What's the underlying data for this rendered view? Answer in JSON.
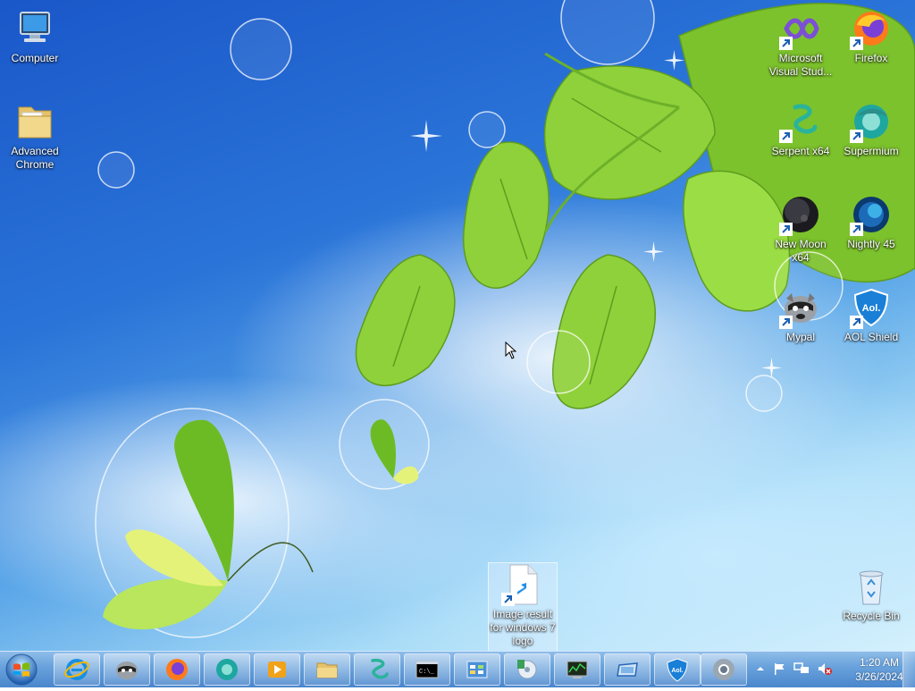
{
  "desktop": {
    "left_icons": [
      {
        "label": "Computer",
        "icon": "computer-icon"
      },
      {
        "label": "Advanced Chrome",
        "icon": "folder-icon"
      }
    ],
    "right_icons": [
      {
        "label": "Microsoft Visual Stud...",
        "icon": "visual-studio-icon"
      },
      {
        "label": "Firefox",
        "icon": "firefox-icon"
      },
      {
        "label": "Serpent x64",
        "icon": "serpent-icon"
      },
      {
        "label": "Supermium",
        "icon": "supermium-icon"
      },
      {
        "label": "New Moon x64",
        "icon": "new-moon-icon"
      },
      {
        "label": "Nightly 45",
        "icon": "nightly-icon"
      },
      {
        "label": "Mypal",
        "icon": "mypal-icon"
      },
      {
        "label": "AOL Shield",
        "icon": "aol-shield-icon"
      }
    ],
    "bottom_icons": [
      {
        "label": "Image result for windows 7 logo",
        "icon": "bing-file-icon"
      },
      {
        "label": "Recycle Bin",
        "icon": "recycle-bin-icon"
      }
    ]
  },
  "taskbar": {
    "start_icon": "windows-start-icon",
    "pinned": [
      "internet-explorer-icon",
      "mypal-icon",
      "firefox-icon",
      "supermium-icon",
      "media-player-icon",
      "file-explorer-icon",
      "serpent-icon",
      "command-prompt-icon",
      "control-panel-icon",
      "media-center-icon",
      "task-manager-icon",
      "window-icon",
      "aol-shield-icon",
      "chrome-icon"
    ],
    "tray": {
      "time": "1:20 AM",
      "date": "3/26/2024"
    }
  },
  "colors": {
    "desktop_blue": "#2a74d8",
    "leaf_green": "#8fd13a",
    "taskbar_blue": "#6aa3dc"
  }
}
